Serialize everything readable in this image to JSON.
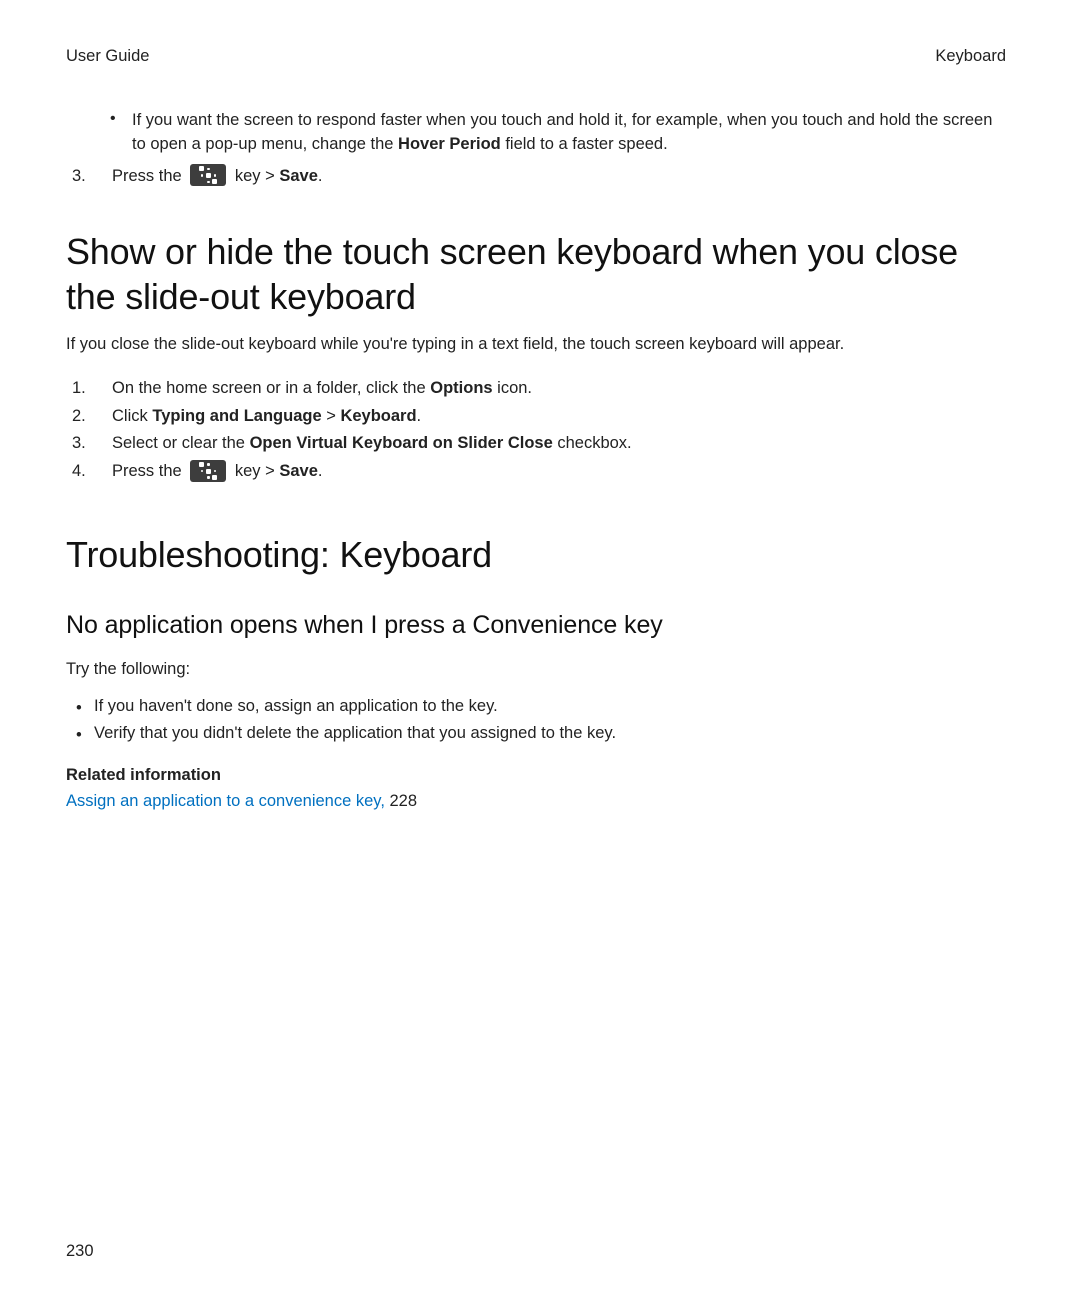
{
  "header": {
    "left": "User Guide",
    "right": "Keyboard"
  },
  "top_bullet": {
    "text_a": "If you want the screen to respond faster when you touch and hold it, for example, when you touch and hold the screen to open a pop-up menu, change the ",
    "bold": "Hover Period",
    "text_b": " field to a faster speed."
  },
  "top_step3": {
    "num": "3.",
    "pre": "Press the ",
    "mid": " key > ",
    "save": "Save",
    "post": "."
  },
  "h1_a": "Show or hide the touch screen keyboard when you close the slide-out keyboard",
  "para_a": "If you close the slide-out keyboard while you're typing in a text field, the touch screen keyboard will appear.",
  "steps_a": [
    {
      "num": "1.",
      "text_a": "On the home screen or in a folder, click the ",
      "bold": "Options",
      "text_b": " icon."
    },
    {
      "num": "2.",
      "text_a": "Click ",
      "bold": "Typing and Language",
      "mid": " > ",
      "bold2": "Keyboard",
      "text_b": "."
    },
    {
      "num": "3.",
      "text_a": "Select or clear the ",
      "bold": "Open Virtual Keyboard on Slider Close",
      "text_b": " checkbox."
    },
    {
      "num": "4.",
      "text_a": "Press the ",
      "mid": " key > ",
      "bold": "Save",
      "text_b": ".",
      "has_icon": true
    }
  ],
  "h1_b": "Troubleshooting: Keyboard",
  "h2_a": "No application opens when I press a Convenience key",
  "para_b": "Try the following:",
  "bullets_b": [
    "If you haven't done so, assign an application to the key.",
    "Verify that you didn't delete the application that you assigned to the key."
  ],
  "related": {
    "heading": "Related information",
    "link_text": "Assign an application to a convenience key,",
    "page_ref": " 228"
  },
  "page_number": "230"
}
